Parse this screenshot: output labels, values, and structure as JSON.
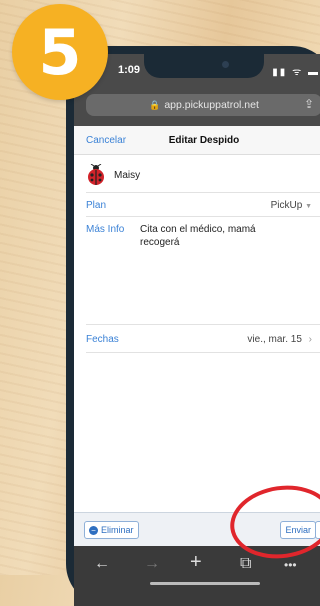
{
  "step_badge": "5",
  "status": {
    "time": "1:09",
    "icons": "▮▮ ᯤ ▬"
  },
  "browser": {
    "url": "app.pickuppatrol.net"
  },
  "nav": {
    "cancel": "Cancelar",
    "title": "Editar Despido"
  },
  "student": {
    "name": "Maisy"
  },
  "fields": {
    "plan_label": "Plan",
    "plan_value": "PickUp",
    "info_label": "Más Info",
    "info_value": "Cita con el médico, mamá recogerá",
    "dates_label": "Fechas",
    "dates_value": "vie., mar. 15"
  },
  "toolbar": {
    "delete_label": "Eliminar",
    "send_label": "Enviar",
    "more_label": "···"
  },
  "browser_toolbar": {
    "back": "←",
    "forward": "→",
    "add": "+",
    "tabs": "⧉",
    "menu": "•••"
  },
  "colors": {
    "accent": "#3b82d6",
    "badge": "#f6b123",
    "annotation": "#e0262c"
  }
}
